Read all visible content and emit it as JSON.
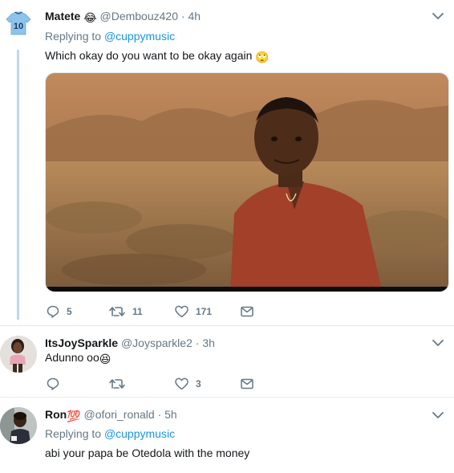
{
  "tweets": [
    {
      "name": "Matete",
      "name_emoji": "😂",
      "handle": "@Dembouz420",
      "time": "· 4h",
      "replying_prefix": "Replying to",
      "replying_to": "@cuppymusic",
      "text": "Which okay do you want to be okay again",
      "text_emoji": "🙄",
      "jersey_number": "10",
      "counts": {
        "reply": "5",
        "retweet": "11",
        "like": "171"
      }
    },
    {
      "name": "ItsJoySparkle",
      "handle": "@Joysparkle2",
      "time": "· 3h",
      "text": "Adunno oo",
      "text_emoji": "😆",
      "counts": {
        "reply": "",
        "retweet": "",
        "like": "3"
      }
    },
    {
      "name": "Ron",
      "name_emoji": "💯",
      "handle": "@ofori_ronald",
      "time": "· 5h",
      "replying_prefix": "Replying to",
      "replying_to": "@cuppymusic",
      "text": "abi your papa be Otedola with the money"
    }
  ],
  "icons": {
    "reply": "reply-icon",
    "retweet": "retweet-icon",
    "like": "heart-icon",
    "dm": "envelope-icon",
    "more": "chevron-down-icon"
  },
  "colors": {
    "text": "#14171a",
    "secondary": "#657786",
    "link": "#1b95e0",
    "thread_line": "#bcd8ec",
    "divider": "#e6ecf0"
  }
}
